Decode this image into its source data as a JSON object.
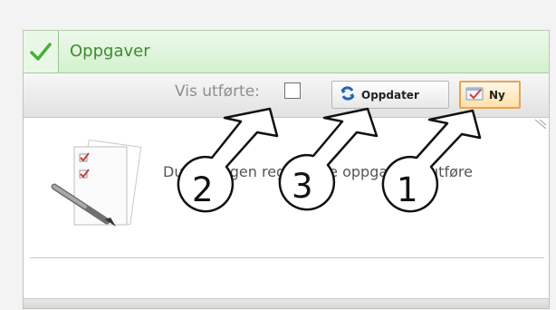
{
  "panel": {
    "title": "Oppgaver",
    "header_icon": "check-icon"
  },
  "toolbar": {
    "show_completed_label": "Vis utførte:",
    "show_completed_checked": false,
    "update_button_label": "Oppdater",
    "update_button_icon": "refresh-icon",
    "new_button_label": "Ny",
    "new_button_icon": "new-task-icon"
  },
  "content": {
    "empty_message": "Du har ingen registrerte oppgaver å utføre",
    "illustration_icon": "task-checklist-icon"
  },
  "callouts": [
    "2",
    "3",
    "1"
  ],
  "colors": {
    "header_green": "#d3f0cd",
    "title_green": "#3f8b31",
    "new_button_border": "#e8a353"
  }
}
